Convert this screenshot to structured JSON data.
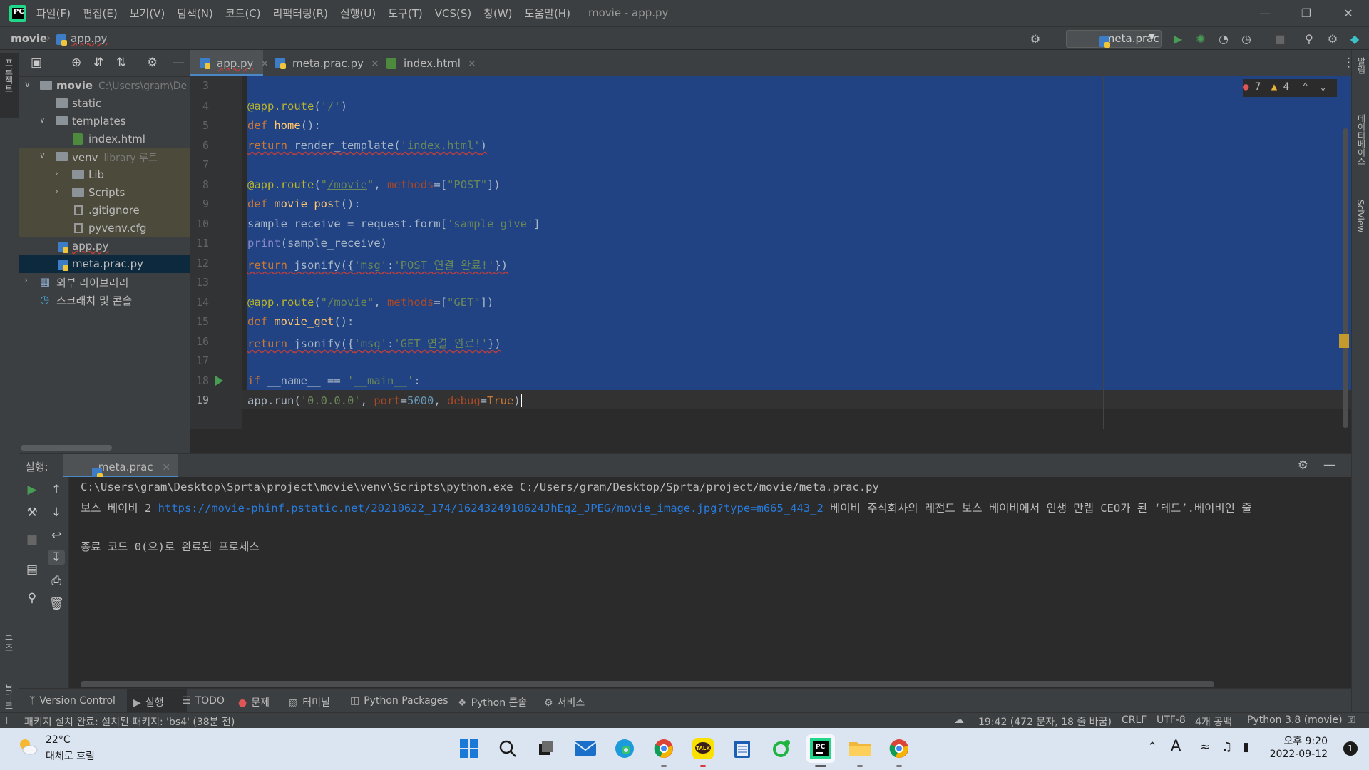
{
  "titlebar": {
    "menu": [
      "파일(F)",
      "편집(E)",
      "보기(V)",
      "탐색(N)",
      "코드(C)",
      "리팩터링(R)",
      "실행(U)",
      "도구(T)",
      "VCS(S)",
      "창(W)",
      "도움말(H)"
    ],
    "window_title": "movie - app.py"
  },
  "navbar": {
    "crumb_root": "movie",
    "crumb_file": "app.py",
    "run_config": "meta.prac"
  },
  "left_stripe": {
    "project_label": "프로젝트",
    "structure_label": "구조",
    "bookmarks_label": "북마크"
  },
  "right_stripe": {
    "notifications": "알림",
    "database": "데이터베이스",
    "sciview": "SciView"
  },
  "project_tree": [
    {
      "label": "movie",
      "hint": "C:\\Users\\gram\\De"
    },
    {
      "label": "static",
      "hint": ""
    },
    {
      "label": "templates",
      "hint": ""
    },
    {
      "label": "index.html",
      "hint": ""
    },
    {
      "label": "venv",
      "hint": "library 루트"
    },
    {
      "label": "Lib",
      "hint": ""
    },
    {
      "label": "Scripts",
      "hint": ""
    },
    {
      "label": ".gitignore",
      "hint": ""
    },
    {
      "label": "pyvenv.cfg",
      "hint": ""
    },
    {
      "label": "app.py",
      "hint": ""
    },
    {
      "label": "meta.prac.py",
      "hint": ""
    },
    {
      "label": "외부 라이브러리",
      "hint": ""
    },
    {
      "label": "스크래치 및 콘솔",
      "hint": ""
    }
  ],
  "tabs": [
    {
      "label": "app.py"
    },
    {
      "label": "meta.prac.py"
    },
    {
      "label": "index.html"
    }
  ],
  "editor": {
    "line_numbers": [
      "3",
      "4",
      "5",
      "6",
      "7",
      "8",
      "9",
      "10",
      "11",
      "12",
      "13",
      "14",
      "15",
      "16",
      "17",
      "18",
      "19"
    ],
    "errors": "7",
    "warnings": "4"
  },
  "run_panel": {
    "title": "실행:",
    "tab": "meta.prac",
    "cmd_line": "C:\\Users\\gram\\Desktop\\Sprta\\project\\movie\\venv\\Scripts\\python.exe C:/Users/gram/Desktop/Sprta/project/movie/meta.prac.py",
    "out_prefix": "보스 베이비 2 ",
    "out_link": "https://movie-phinf.pstatic.net/20210622_174/1624324910624JhEq2_JPEG/movie_image.jpg?type=m665_443_2",
    "out_suffix": " 베이비 주식회사의 레전드 보스 베이비에서 인생 만렙 CEO가 된 ‘테드’.베이비인 줄",
    "exit_line": "종료 코드 0(으)로 완료된 프로세스"
  },
  "bottom_tabs": [
    "Version Control",
    "실행",
    "TODO",
    "문제",
    "터미널",
    "Python Packages",
    "Python 콘솔",
    "서비스"
  ],
  "statusbar": {
    "message": "패키지 설치 완료: 설치된 패키지: 'bs4' (38분 전)",
    "position": "19:42 (472 문자, 18 줄 바꿈)",
    "line_sep": "CRLF",
    "encoding": "UTF-8",
    "indent": "4개 공백",
    "interpreter": "Python 3.8 (movie)"
  },
  "taskbar": {
    "temp": "22°C",
    "weather": "대체로 흐림",
    "time": "오후 9:20",
    "date": "2022-09-12",
    "notifications": "1",
    "ime": "A"
  }
}
